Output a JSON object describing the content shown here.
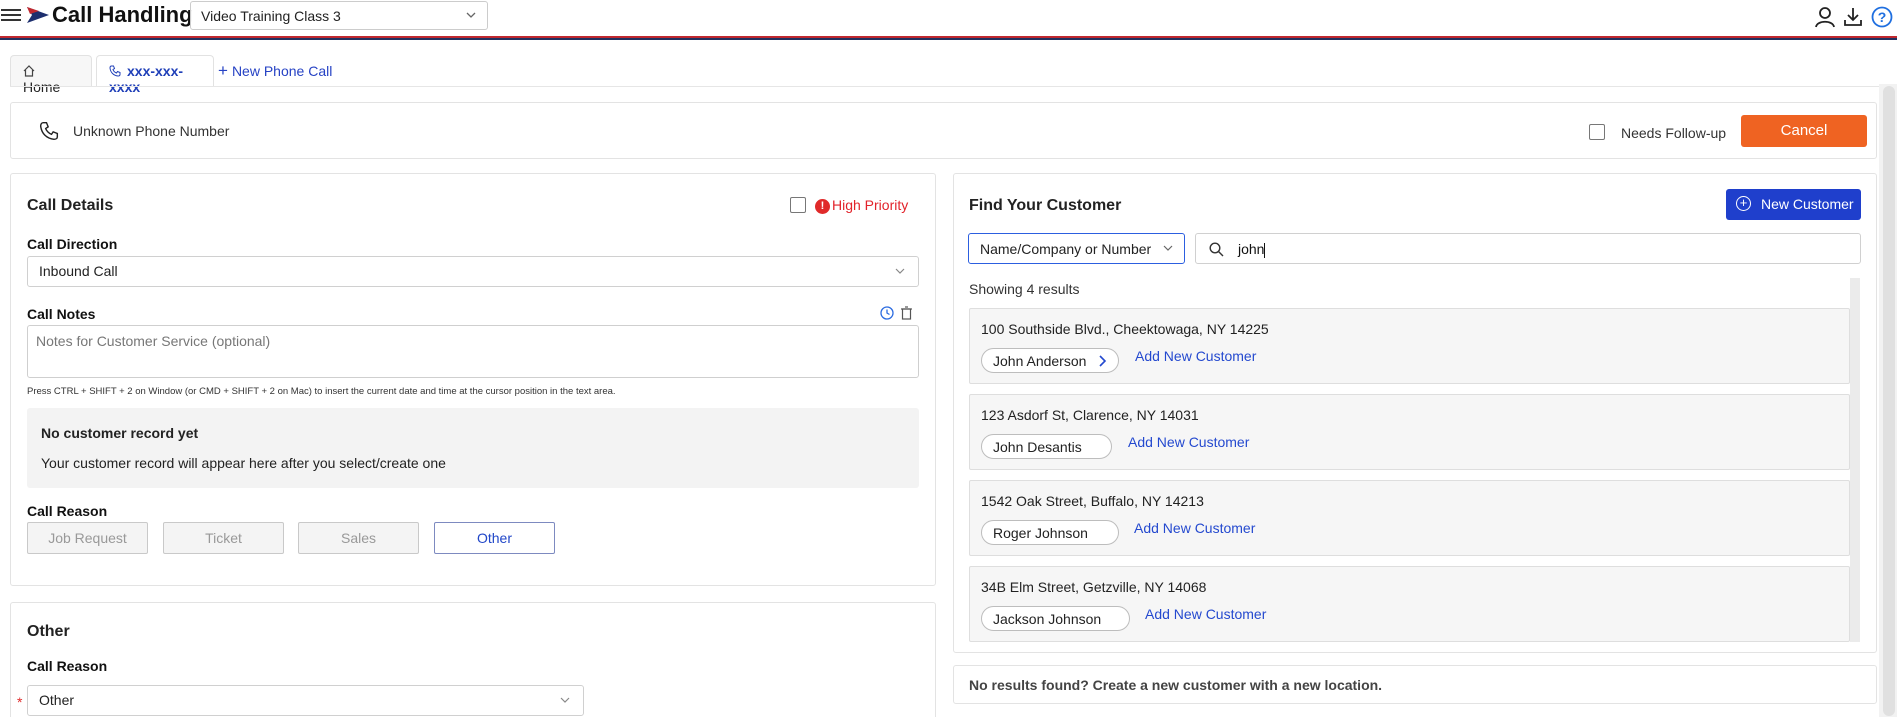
{
  "header": {
    "app_title": "Call Handling",
    "training_class": "Video Training Class 3",
    "icons": [
      "menu-icon",
      "logo-icon",
      "user-icon",
      "download-icon",
      "help-icon"
    ]
  },
  "tabs": {
    "home": "Home",
    "phone": "xxx-xxx-xxxx",
    "new_call": "New Phone Call"
  },
  "call_bar": {
    "caller": "Unknown Phone Number",
    "needs_followup": "Needs Follow-up",
    "cancel": "Cancel"
  },
  "call_details": {
    "title": "Call Details",
    "high_priority": "High Priority",
    "direction_label": "Call Direction",
    "direction_value": "Inbound Call",
    "notes_label": "Call Notes",
    "notes_placeholder": "Notes for Customer Service (optional)",
    "notes_hint": "Press CTRL + SHIFT + 2 on Window (or CMD + SHIFT + 2 on Mac) to insert the current date and time at the cursor position in the text area.",
    "empty_title": "No customer record yet",
    "empty_text": "Your customer record will appear here after you select/create one",
    "reason_label": "Call Reason",
    "reasons": [
      "Job Request",
      "Ticket",
      "Sales",
      "Other"
    ],
    "selected_reason": "Other"
  },
  "other_section": {
    "title": "Other",
    "reason_label": "Call Reason",
    "reason_value": "Other"
  },
  "find_customer": {
    "title": "Find Your Customer",
    "new_customer": "New Customer",
    "search_type": "Name/Company or Number",
    "search_value": "john",
    "showing": "Showing 4 results",
    "results": [
      {
        "address": "100 Southside Blvd., Cheektowaga, NY 14225",
        "name": "John Anderson",
        "add": "Add New Customer"
      },
      {
        "address": "123 Asdorf St, Clarence, NY 14031",
        "name": "John Desantis",
        "add": "Add New Customer"
      },
      {
        "address": "1542 Oak Street, Buffalo, NY 14213",
        "name": "Roger Johnson",
        "add": "Add New Customer"
      },
      {
        "address": "34B Elm Street, Getzville, NY 14068",
        "name": "Jackson Johnson",
        "add": "Add New Customer"
      }
    ],
    "no_results": "No results found? Create a new customer with a new location."
  },
  "colors": {
    "accent_blue": "#1f3fcc",
    "cancel_orange": "#ef6322",
    "priority_red": "#e2222a"
  }
}
